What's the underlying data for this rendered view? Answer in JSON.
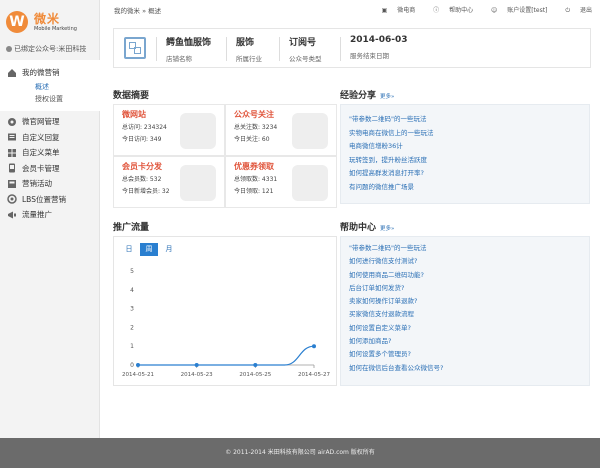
{
  "brand": {
    "logo_letter": "W",
    "name_cn": "微米",
    "name_en": "Mobile Marketing",
    "color": "#f08b3a"
  },
  "account": {
    "bound_text": "已绑定公众号:米田科技"
  },
  "sidebar": {
    "active_group": {
      "label": "我的微营销",
      "icon": "home-icon",
      "subitems": [
        {
          "label": "概述",
          "active": true
        },
        {
          "label": "授权设置",
          "active": false
        }
      ]
    },
    "items": [
      {
        "label": "微官网管理",
        "icon": "site-icon"
      },
      {
        "label": "自定义回复",
        "icon": "reply-icon"
      },
      {
        "label": "自定义菜单",
        "icon": "menu-icon"
      },
      {
        "label": "会员卡管理",
        "icon": "card-icon"
      },
      {
        "label": "营销活动",
        "icon": "activity-icon"
      },
      {
        "label": "LBS位置营销",
        "icon": "location-icon"
      },
      {
        "label": "流量推广",
        "icon": "promote-icon"
      }
    ]
  },
  "topbar": {
    "breadcrumb": "我的微米 » 概述",
    "links": [
      {
        "label": "微电商",
        "icon": "shop-icon"
      },
      {
        "label": "帮助中心",
        "icon": "help-icon"
      },
      {
        "label": "账户设置[test]",
        "icon": "user-icon"
      },
      {
        "label": "退出",
        "icon": "logout-icon"
      }
    ]
  },
  "info": {
    "store_name": {
      "value": "鳄鱼恤服饰",
      "label": "店铺名称"
    },
    "industry": {
      "value": "服饰",
      "label": "所属行业"
    },
    "account_type": {
      "value": "订阅号",
      "label": "公众号类型"
    },
    "service_end": {
      "value": "2014-06-03",
      "label": "服务结束日期"
    }
  },
  "summary": {
    "title": "数据摘要",
    "cells": [
      {
        "title": "微网站",
        "lines": [
          "总访问: 234324",
          "今日访问: 349"
        ]
      },
      {
        "title": "公众号关注",
        "lines": [
          "总关注数: 3234",
          "今日关注: 60"
        ]
      },
      {
        "title": "会员卡分发",
        "lines": [
          "总会员数: 532",
          "今日新增会员: 32"
        ]
      },
      {
        "title": "优惠券领取",
        "lines": [
          "总领取数: 4331",
          "今日领取: 121"
        ]
      }
    ]
  },
  "experience": {
    "title": "经验分享",
    "more": "更多»",
    "links": [
      "\"带参数二维码\"的一些玩法",
      "实物电商在微信上的一些玩法",
      "电商微信增粉36计",
      "玩转签到，提升粉丝活跃度",
      "如何提高群发消息打开率?",
      "有问题的微信推广场景"
    ]
  },
  "traffic": {
    "title": "推广流量",
    "tabs": [
      {
        "label": "日",
        "active": false
      },
      {
        "label": "周",
        "active": true
      },
      {
        "label": "月",
        "active": false
      }
    ]
  },
  "help": {
    "title": "帮助中心",
    "more": "更多»",
    "links": [
      "\"带参数二维码\"的一些玩法",
      "如何进行微信支付测试?",
      "如何使用商品二维码功能?",
      "后台订单如何发货?",
      "卖家如何操作订单退款?",
      "买家微信支付退款流程",
      "如何设置自定义菜单?",
      "如何添加商品?",
      "如何设置多个管理员?",
      "如何在微信后台查看公众微信号?"
    ]
  },
  "chart_data": {
    "type": "line",
    "x": [
      "2014-05-21",
      "2014-05-22",
      "2014-05-23",
      "2014-05-24",
      "2014-05-25",
      "2014-05-26",
      "2014-05-27"
    ],
    "series": [
      {
        "values": [
          0,
          0,
          0,
          0,
          0,
          0,
          1
        ]
      }
    ],
    "x_tick_labels": [
      "2014-05-21",
      "2014-05-23",
      "2014-05-25",
      "2014-05-27"
    ],
    "yticks": [
      0,
      1,
      2,
      3,
      4,
      5
    ],
    "ylim": [
      0,
      5
    ],
    "color": "#2a7fd0",
    "grid": false
  },
  "footer": {
    "text": "© 2011-2014 米田科技有限公司 airAD.com 版权所有"
  }
}
